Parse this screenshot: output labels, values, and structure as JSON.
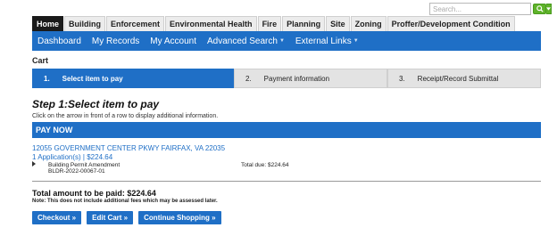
{
  "search": {
    "placeholder": "Search..."
  },
  "module_tabs": [
    {
      "label": "Home",
      "active": true
    },
    {
      "label": "Building"
    },
    {
      "label": "Enforcement"
    },
    {
      "label": "Environmental Health"
    },
    {
      "label": "Fire"
    },
    {
      "label": "Planning"
    },
    {
      "label": "Site"
    },
    {
      "label": "Zoning"
    },
    {
      "label": "Proffer/Development Condition"
    }
  ],
  "navbar": {
    "dashboard": "Dashboard",
    "my_records": "My Records",
    "my_account": "My Account",
    "advanced_search": "Advanced Search",
    "external_links": "External Links"
  },
  "cart": {
    "title": "Cart",
    "steps": [
      {
        "num": "1.",
        "label": "Select item to pay",
        "active": true
      },
      {
        "num": "2.",
        "label": "Payment information"
      },
      {
        "num": "3.",
        "label": "Receipt/Record Submittal"
      }
    ],
    "step_heading": "Step 1:Select item to pay",
    "instruction": "Click on the arrow in front of a row to display additional information.",
    "pay_now": "PAY NOW",
    "address": "12055 GOVERNMENT CENTER PKWY FAIRFAX, VA 22035",
    "applications": "1 Application(s) | $224.64",
    "record_type": "Building Permit Amendment",
    "record_id": "BLDR-2022-00067-01",
    "total_due": "Total due: $224.64",
    "total_amount": "Total amount to be paid: $224.64",
    "note": "Note: This does not include additional fees which may be assessed later."
  },
  "actions": {
    "checkout": "Checkout »",
    "edit_cart": "Edit Cart »",
    "continue_shopping": "Continue Shopping »"
  },
  "colors": {
    "primary_blue": "#1f6fc6",
    "search_green": "#5fb32a",
    "active_tab": "#1a1a1a"
  }
}
